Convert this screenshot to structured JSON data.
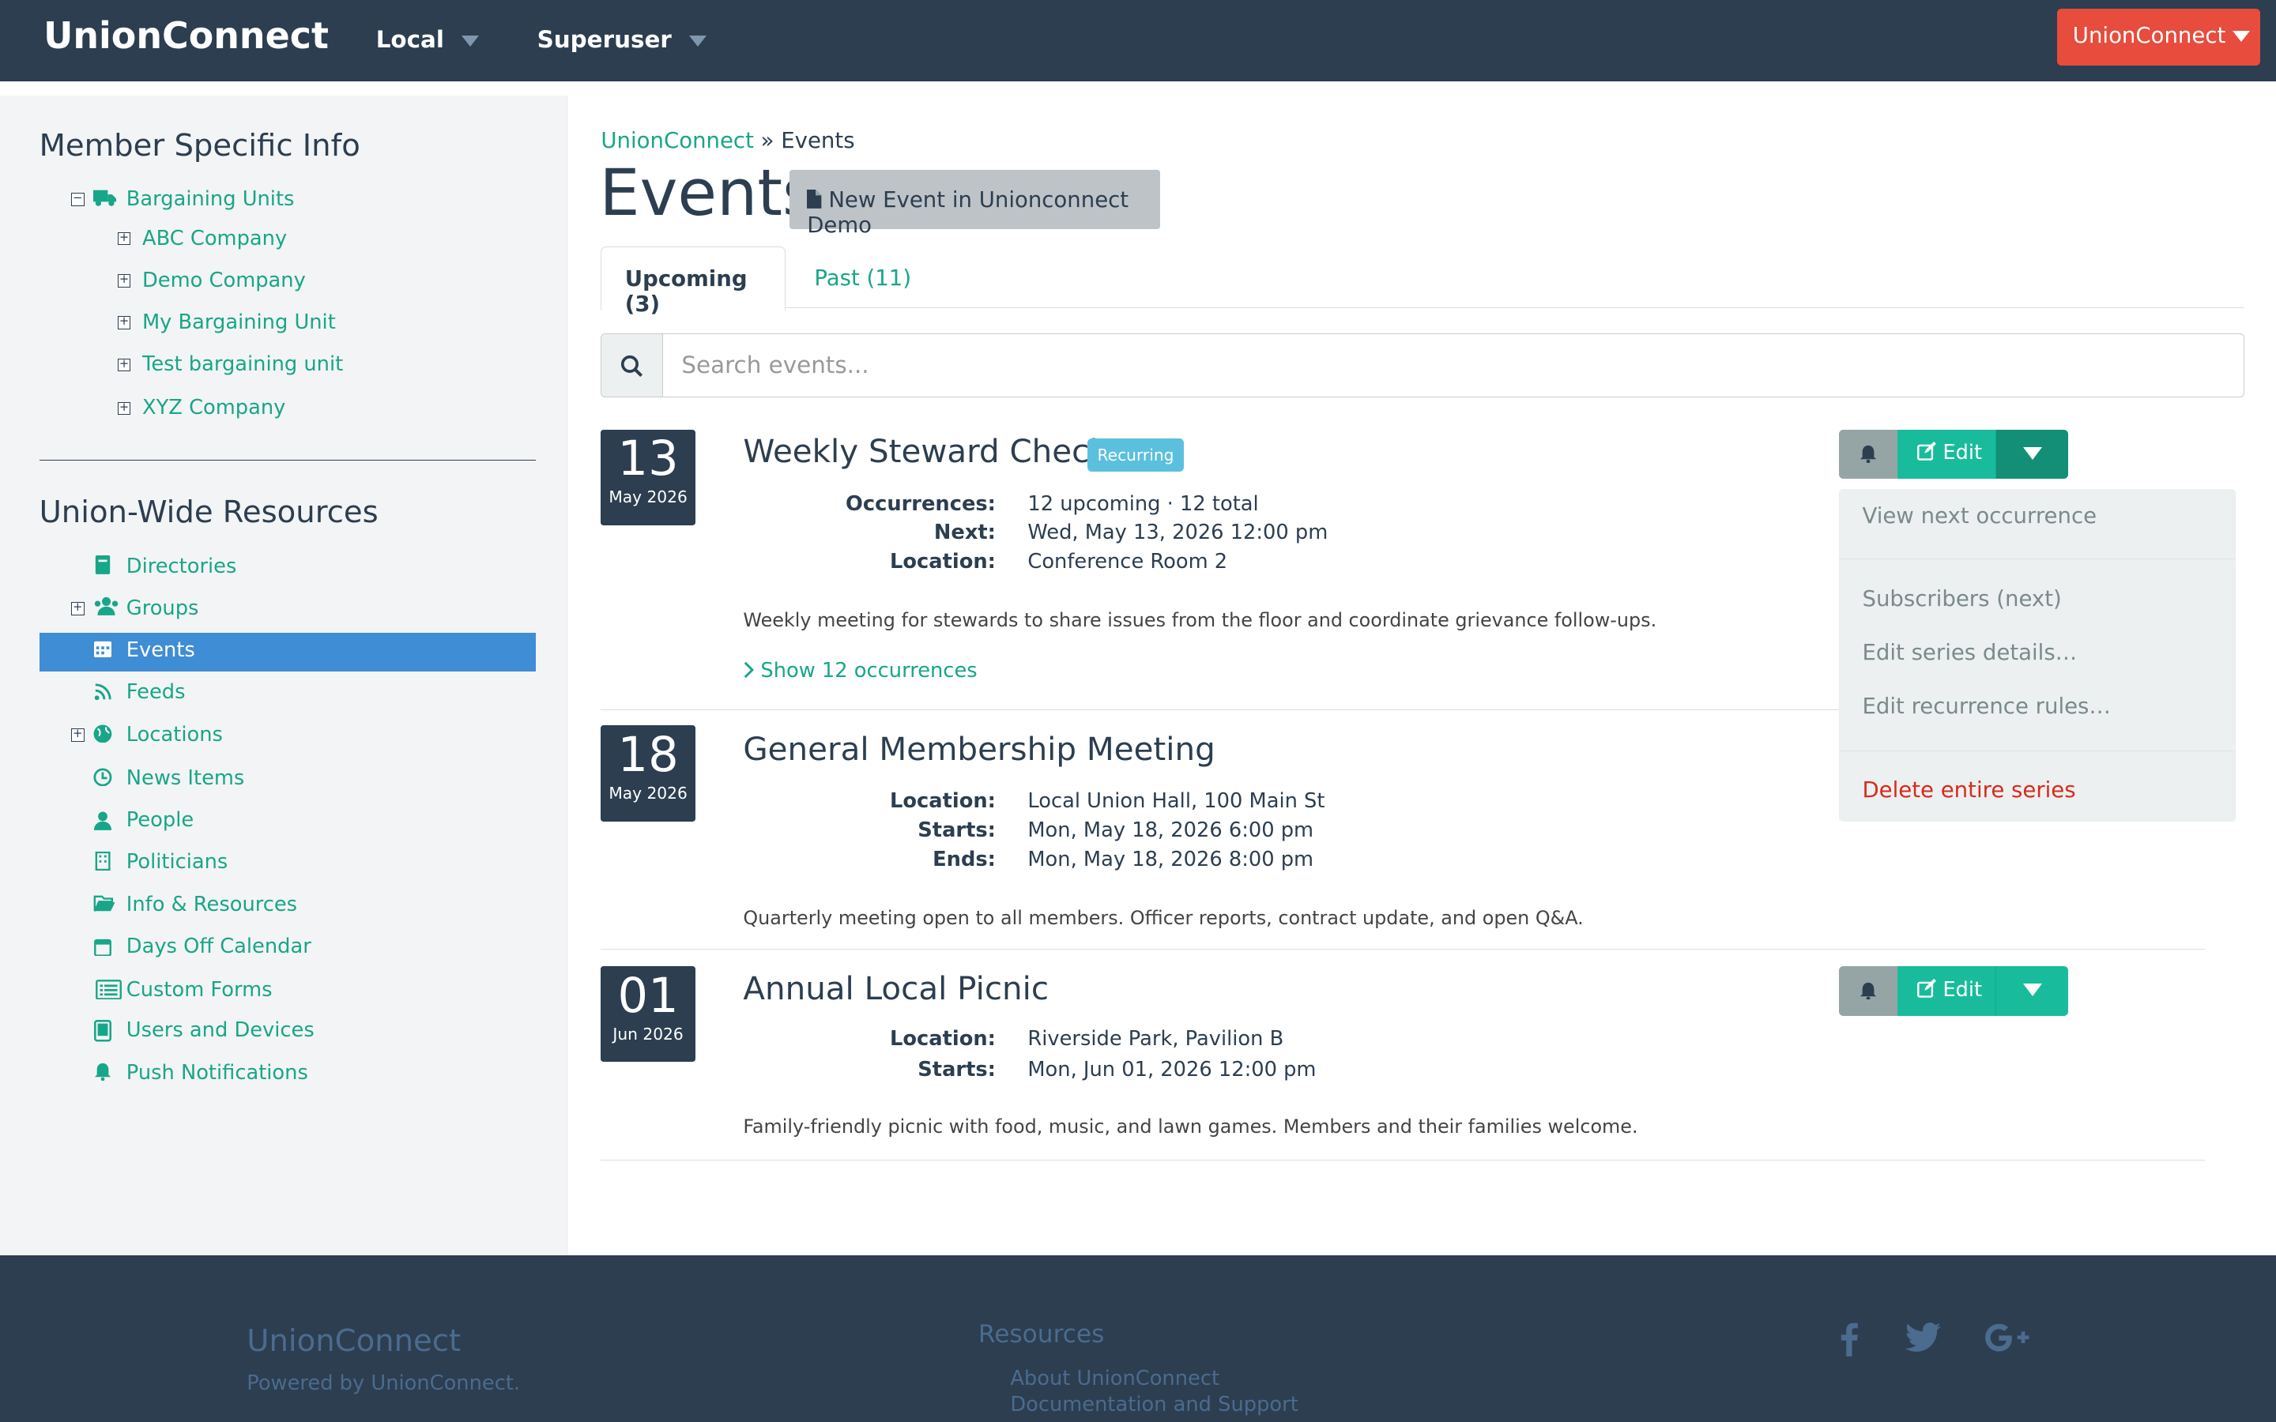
{
  "navbar": {
    "brand": "UnionConnect",
    "local_label": "Local",
    "superuser_label": "Superuser",
    "right_button_label": "UnionConnect"
  },
  "sidebar": {
    "member_heading": "Member Specific Info",
    "bargaining_units_label": "Bargaining Units",
    "bargaining_units": [
      "ABC Company",
      "Demo Company",
      "My Bargaining Unit",
      "Test bargaining unit",
      "XYZ Company"
    ],
    "resources_heading": "Union-Wide Resources",
    "resources": [
      {
        "label": "Directories",
        "icon": "book-icon",
        "expandable": false
      },
      {
        "label": "Groups",
        "icon": "users-icon",
        "expandable": true
      },
      {
        "label": "Events",
        "icon": "calendar-icon",
        "expandable": false,
        "active": true
      },
      {
        "label": "Feeds",
        "icon": "rss-icon",
        "expandable": false
      },
      {
        "label": "Locations",
        "icon": "globe-icon",
        "expandable": true
      },
      {
        "label": "News Items",
        "icon": "clock-icon",
        "expandable": false
      },
      {
        "label": "People",
        "icon": "user-icon",
        "expandable": false
      },
      {
        "label": "Politicians",
        "icon": "building-icon",
        "expandable": false
      },
      {
        "label": "Info & Resources",
        "icon": "folder-open-icon",
        "expandable": false
      },
      {
        "label": "Days Off Calendar",
        "icon": "calendar-icon",
        "expandable": false
      },
      {
        "label": "Custom Forms",
        "icon": "list-icon",
        "expandable": false
      },
      {
        "label": "Users and Devices",
        "icon": "tablet-icon",
        "expandable": false
      },
      {
        "label": "Push Notifications",
        "icon": "bell-icon",
        "expandable": false
      }
    ]
  },
  "breadcrumb": {
    "root": "UnionConnect",
    "separator": "»",
    "current": "Events"
  },
  "page": {
    "title": "Events",
    "new_event_label": "New Event in Unionconnect Demo",
    "tabs": [
      {
        "label": "Upcoming (3)",
        "active": true
      },
      {
        "label": "Past (11)",
        "active": false
      }
    ],
    "search_placeholder": "Search events..."
  },
  "events": [
    {
      "day": "13",
      "month": "May 2026",
      "title": "Weekly Steward Check-In",
      "badge": "Recurring",
      "fields": [
        {
          "label": "Occurrences:",
          "value": "12 upcoming · 12 total"
        },
        {
          "label": "Next:",
          "value": "Wed, May 13, 2026 12:00 pm"
        },
        {
          "label": "Location:",
          "value": "Conference Room 2"
        }
      ],
      "description": "Weekly meeting for stewards to share issues from the floor and coordinate grievance follow-ups.",
      "show_occurrences": "Show 12 occurrences",
      "edit_label": "Edit"
    },
    {
      "day": "18",
      "month": "May 2026",
      "title": "General Membership Meeting",
      "fields": [
        {
          "label": "Location:",
          "value": "Local Union Hall, 100 Main St"
        },
        {
          "label": "Starts:",
          "value": "Mon, May 18, 2026 6:00 pm"
        },
        {
          "label": "Ends:",
          "value": "Mon, May 18, 2026 8:00 pm"
        }
      ],
      "description": "Quarterly meeting open to all members. Officer reports, contract update, and open Q&A."
    },
    {
      "day": "01",
      "month": "Jun 2026",
      "title": "Annual Local Picnic",
      "fields": [
        {
          "label": "Location:",
          "value": "Riverside Park, Pavilion B"
        },
        {
          "label": "Starts:",
          "value": "Mon, Jun 01, 2026 12:00 pm"
        }
      ],
      "description": "Family-friendly picnic with food, music, and lawn games. Members and their families welcome.",
      "edit_label": "Edit"
    }
  ],
  "dropdown": {
    "items": [
      "View next occurrence",
      "Subscribers (next)",
      "Edit series details…",
      "Edit recurrence rules…"
    ],
    "danger_item": "Delete entire series"
  },
  "footer": {
    "brand": "UnionConnect",
    "powered": "Powered by UnionConnect.",
    "resources_heading": "Resources",
    "links": [
      "About UnionConnect",
      "Documentation and Support"
    ],
    "social": [
      "facebook-icon",
      "twitter-icon",
      "google-plus-icon"
    ]
  },
  "colors": {
    "navbar": "#2c3e50",
    "accent": "#18bc9c",
    "active_nav": "#3f8dd5",
    "danger": "#e74c3c"
  }
}
